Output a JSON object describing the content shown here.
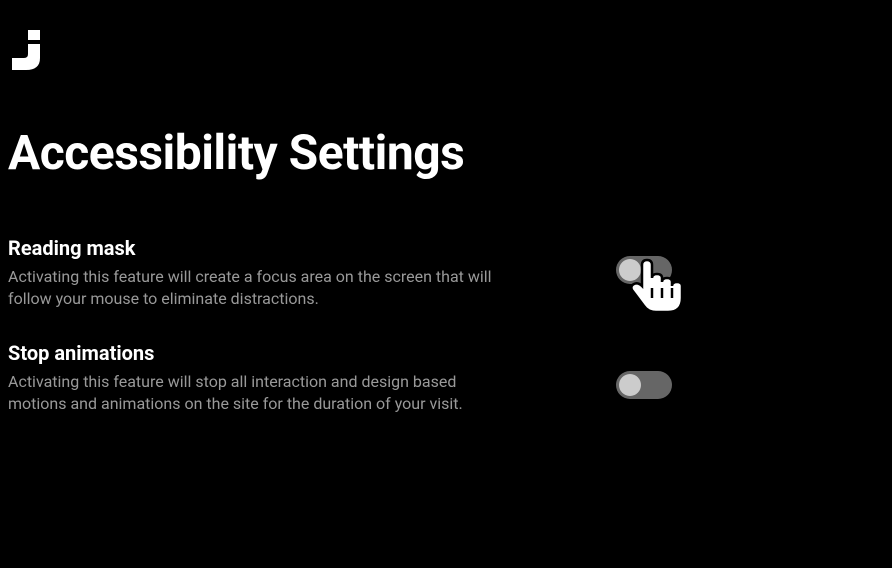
{
  "page": {
    "title": "Accessibility Settings"
  },
  "settings": [
    {
      "title": "Reading mask",
      "description": "Activating this feature will create a focus area on the screen that will follow your mouse to eliminate distractions.",
      "enabled": false
    },
    {
      "title": "Stop animations",
      "description": "Activating this feature will stop all interaction and design based motions and animations on the site for the duration of your visit.",
      "enabled": false
    }
  ]
}
